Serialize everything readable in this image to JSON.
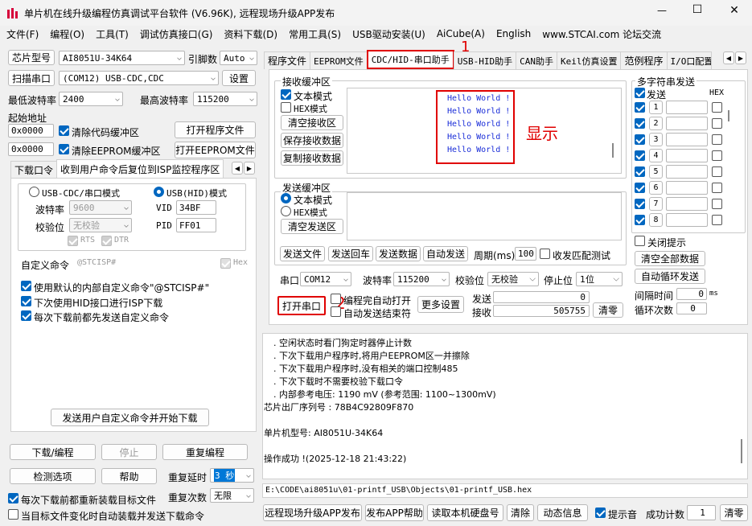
{
  "window": {
    "title": "单片机在线升级编程仿真调试平台软件 (V6.96K), 远程现场升级APP发布",
    "minimize": "—",
    "maximize": "☐",
    "close": "✕"
  },
  "menu": [
    "文件(F)",
    "编程(O)",
    "工具(T)",
    "调试仿真接口(G)",
    "资料下载(D)",
    "常用工具(S)",
    "USB驱动安装(U)",
    "AiCube(A)",
    "English",
    "www.STCAI.com 论坛交流"
  ],
  "left": {
    "chip_label": "芯片型号",
    "chip_value": "AI8051U-34K64",
    "pins_label": "引脚数",
    "pins_value": "Auto",
    "scan_label": "扫描串口",
    "port_value": "(COM12) USB-CDC,CDC",
    "settings_label": "设置",
    "min_baud_label": "最低波特率",
    "min_baud_value": "2400",
    "max_baud_label": "最高波特率",
    "max_baud_value": "115200",
    "start_addr_label": "起始地址",
    "addr1": "0x0000",
    "clear_code": "清除代码缓冲区",
    "open_program": "打开程序文件",
    "addr2": "0x0000",
    "clear_eeprom": "清除EEPROM缓冲区",
    "open_eeprom": "打开EEPROM文件",
    "tabs": [
      "下载口令",
      "收到用户命令后复位到ISP监控程序区"
    ],
    "usb_cdc_mode": "USB-CDC/串口模式",
    "usb_hid_mode": "USB(HID)模式",
    "baud_label": "波特率",
    "baud_value": "9600",
    "vid_label": "VID",
    "vid_value": "34BF",
    "parity_label": "校验位",
    "parity_value": "无校验",
    "pid_label": "PID",
    "pid_value": "FF01",
    "rts": "RTS",
    "dtr": "DTR",
    "custom_cmd_label": "自定义命令",
    "custom_cmd_value": "@STCISP#",
    "hex_label": "Hex",
    "opt1": "使用默认的内部自定义命令\"@STCISP#\"",
    "opt2": "下次使用HID接口进行ISP下载",
    "opt3": "每次下载前都先发送自定义命令",
    "send_custom": "发送用户自定义命令并开始下载",
    "download": "下载/编程",
    "stop": "停止",
    "reprogram": "重复编程",
    "detect": "检测选项",
    "help": "帮助",
    "delay_label": "重复延时",
    "delay_value": "3 秒",
    "reload": "每次下载前都重新装载目标文件",
    "count_label": "重复次数",
    "count_value": "无限",
    "auto_load": "当目标文件变化时自动装载并发送下载命令"
  },
  "right": {
    "tabs": [
      "程序文件",
      "EEPROM文件",
      "CDC/HID-串口助手",
      "USB-HID助手",
      "CAN助手",
      "Keil仿真设置",
      "范例程序",
      "I/O口配置"
    ],
    "rx_title": "接收缓冲区",
    "text_mode": "文本模式",
    "hex_mode": "HEX模式",
    "clear_rx": "清空接收区",
    "save_rx": "保存接收数据",
    "copy_rx": "复制接收数据",
    "rx_lines": [
      "Hello World !",
      "Hello World !",
      "Hello World !",
      "Hello World !",
      "Hello World !"
    ],
    "annot_display": "显示",
    "annot_1": "1",
    "annot_2": "2",
    "annot_color": "#e00000",
    "tx_title": "发送缓冲区",
    "clear_tx": "清空发送区",
    "send_file": "发送文件",
    "send_return": "发送回车",
    "send_data": "发送数据",
    "auto_send": "自动发送",
    "period_label": "周期(ms)",
    "period_value": "100",
    "match_label": "收发匹配测试",
    "multi_title": "多字符串发送",
    "send_col": "发送",
    "hex_col": "HEX",
    "multi_rows": [
      "1",
      "2",
      "3",
      "4",
      "5",
      "6",
      "7",
      "8"
    ],
    "close_tip": "关闭提示",
    "clear_all": "清空全部数据",
    "auto_loop": "自动循环发送",
    "interval_label": "间隔时间",
    "interval_value": "0",
    "interval_unit": "ms",
    "loop_label": "循环次数",
    "loop_value": "0",
    "port_label": "串口",
    "port_value": "COM12",
    "baud_label": "波特率",
    "baud_value": "115200",
    "parity_label": "校验位",
    "parity_value": "无校验",
    "stop_label": "停止位",
    "stop_value": "1位",
    "open_port": "打开串口",
    "auto_open": "编程完自动打开",
    "auto_send_end": "自动发送结束符",
    "more_settings": "更多设置",
    "send_label": "发送",
    "send_count": "0",
    "recv_label": "接收",
    "recv_count": "505755",
    "clear_count": "清零"
  },
  "log": {
    "lines": [
      ". 空闲状态时看门狗定时器停止计数",
      ". 下次下载用户程序时,将用户EEPROM区一并擦除",
      ". 下次下载用户程序时,没有相关的端口控制485",
      ". 下次下载时不需要校验下载口令",
      ". 内部参考电压: 1190 mV (参考范围: 1100~1300mV)",
      "芯片出厂序列号 : 78B4C92809F870",
      "",
      "  单片机型号: AI8051U-34K64",
      "",
      "操作成功 !(2025-12-18 21:43:22)"
    ],
    "path": "E:\\CODE\\ai8051u\\01-printf_USB\\Objects\\01-printf_USB.hex"
  },
  "bottom": {
    "remote": "远程现场升级APP发布",
    "publish_help": "发布APP帮助",
    "read_disk": "读取本机硬盘号",
    "clear": "清除",
    "dynamic": "动态信息",
    "sound": "提示音",
    "success_label": "成功计数",
    "success_value": "1",
    "clear_zero": "清零"
  }
}
